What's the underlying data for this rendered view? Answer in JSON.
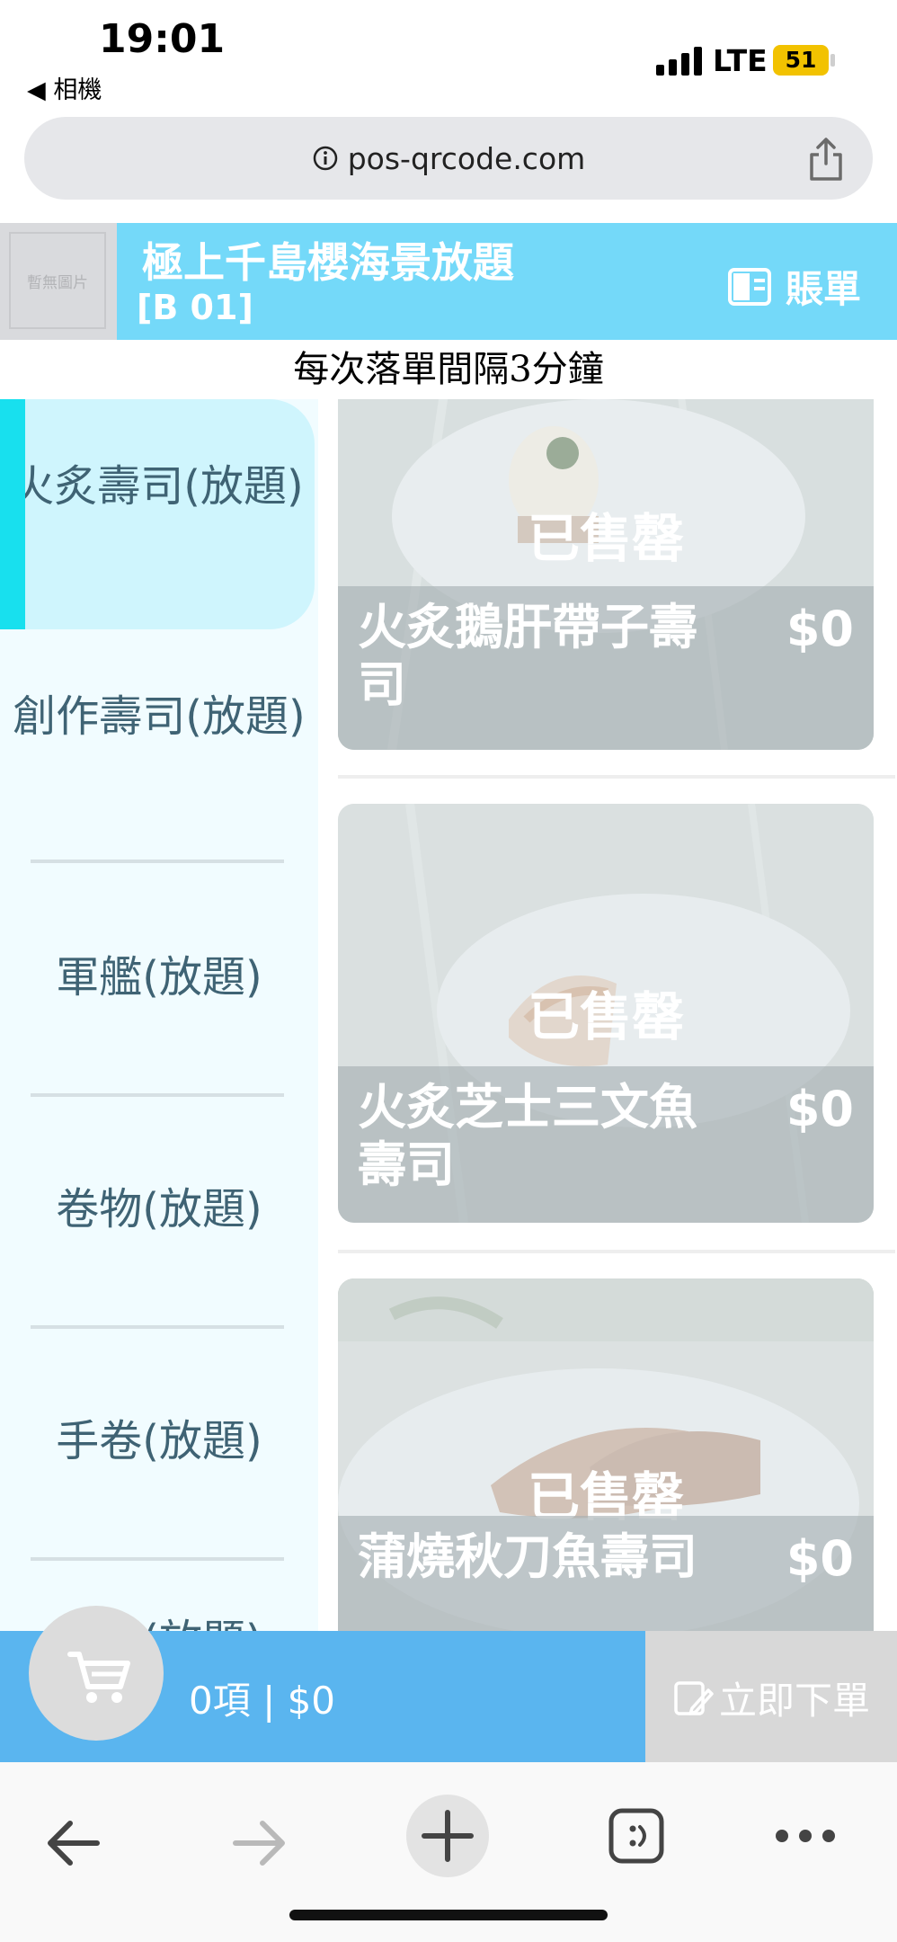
{
  "status": {
    "time": "19:01",
    "back_app": "◀ 相機",
    "network": "LTE",
    "battery": "51"
  },
  "browser": {
    "url": "pos-qrcode.com"
  },
  "header": {
    "logo_text": "暫無圖片",
    "shop_name": "極上千島櫻海景放題",
    "table_no": "[B 01]",
    "bill_label": "賬單"
  },
  "notice": "每次落單間隔3分鐘",
  "sidebar": {
    "categories": [
      {
        "label": "火炙壽司(放題)"
      },
      {
        "label": "創作壽司(放題)"
      },
      {
        "label": "軍艦(放題)"
      },
      {
        "label": "卷物(放題)"
      },
      {
        "label": "手卷(放題)"
      },
      {
        "label": "刺身(放題)"
      }
    ]
  },
  "products": [
    {
      "name": "火炙鵝肝帶子壽司",
      "price": "$0",
      "status": "已售罄"
    },
    {
      "name": "火炙芝士三文魚壽司",
      "price": "$0",
      "status": "已售罄"
    },
    {
      "name": "蒲燒秋刀魚壽司",
      "price": "$0",
      "status": "已售罄"
    }
  ],
  "cart": {
    "summary": "0項 | $0",
    "order_label": "立即下單"
  },
  "colors": {
    "header": "#74d9f9",
    "cart_bar": "#5ab5ef",
    "active_category": "#cff5fd",
    "accent_bar": "#18e0ee"
  }
}
